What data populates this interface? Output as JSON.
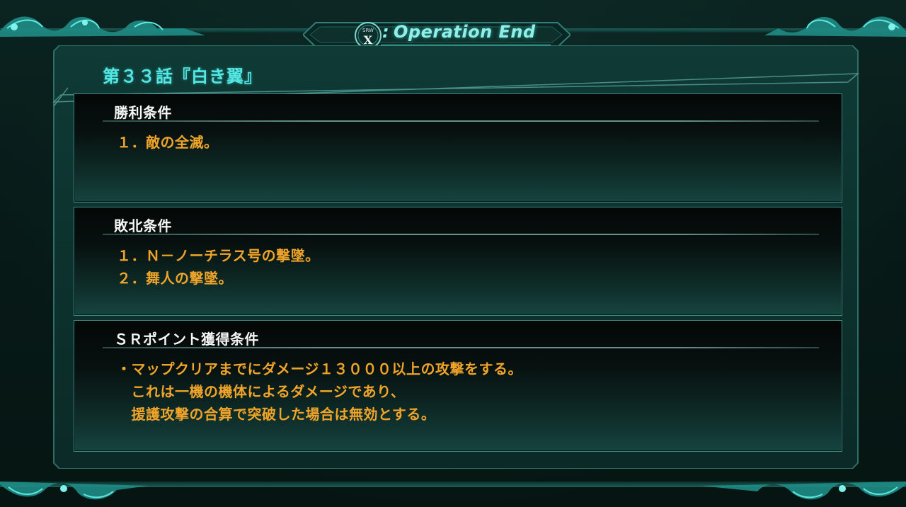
{
  "header": {
    "logo_text": "SRW X",
    "title_prefix": ":",
    "title": "Operation End"
  },
  "stage": {
    "title": "第３３話『白き翼』"
  },
  "victory": {
    "heading": "勝利条件",
    "lines": [
      "１．敵の全滅。"
    ]
  },
  "defeat": {
    "heading": "敗北条件",
    "lines": [
      "１．Ｎ－ノーチラス号の撃墜。",
      "２．舞人の撃墜。"
    ]
  },
  "sr_point": {
    "heading": "ＳＲポイント獲得条件",
    "lines": [
      "・マップクリアまでにダメージ１３０００以上の攻撃をする。",
      "　これは一機の機体によるダメージであり、",
      "　援護攻撃の合算で突破した場合は無効とする。"
    ]
  },
  "colors": {
    "accent_cyan": "#54e7e3",
    "condition_orange": "#f0a52a",
    "heading_white": "#f4f6f4",
    "frame_teal": "#3d8c86"
  }
}
